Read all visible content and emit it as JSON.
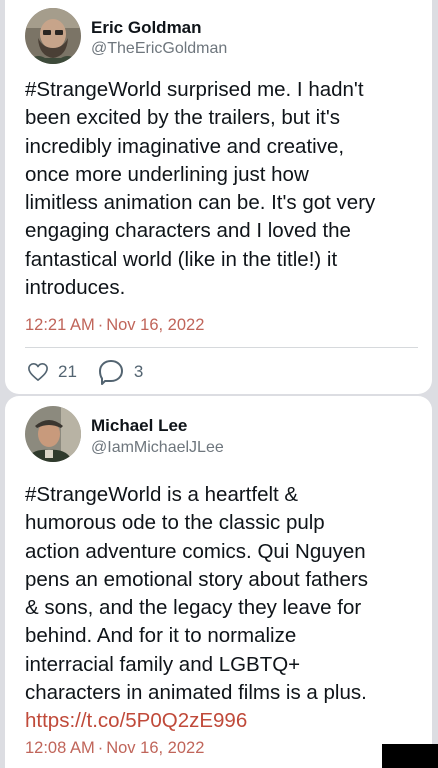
{
  "tweets": [
    {
      "author": {
        "name": "Eric Goldman",
        "handle": "@TheEricGoldman",
        "avatar_icon": "bearded-man-photo"
      },
      "text_lines": [
        "#StrangeWorld surprised me. I hadn't",
        "been excited by the trailers, but it's",
        "incredibly imaginative and creative,",
        "once more underlining just how",
        "limitless animation can be. It's got very",
        "engaging characters and I loved the",
        "fantastical world (like in the title!) it",
        "introduces."
      ],
      "time": "12:21 AM",
      "separator": "·",
      "date": "Nov 16, 2022",
      "likes": "21",
      "replies": "3",
      "like_icon": "heart-outline-icon",
      "reply_icon": "speech-bubble-icon"
    },
    {
      "author": {
        "name": "Michael Lee",
        "handle": "@IamMichaelJLee",
        "avatar_icon": "man-in-hat-photo"
      },
      "text_lines": [
        "#StrangeWorld is a heartfelt &",
        "humorous ode to the classic pulp",
        "action adventure comics. Qui Nguyen",
        "pens an emotional story about fathers",
        "& sons, and the legacy they leave for",
        "behind. And for it to normalize",
        "interracial family and LGBTQ+",
        "characters in animated films is a plus."
      ],
      "link": "https://t.co/5P0Q2zE996",
      "time": "12:08 AM",
      "separator": "·",
      "date": "Nov 16, 2022"
    }
  ],
  "colors": {
    "background": "#dcdde2",
    "card": "#ffffff",
    "text": "#0f1419",
    "secondary": "#6e767d",
    "link": "#c04a3a",
    "timestamp": "#c0655a"
  }
}
